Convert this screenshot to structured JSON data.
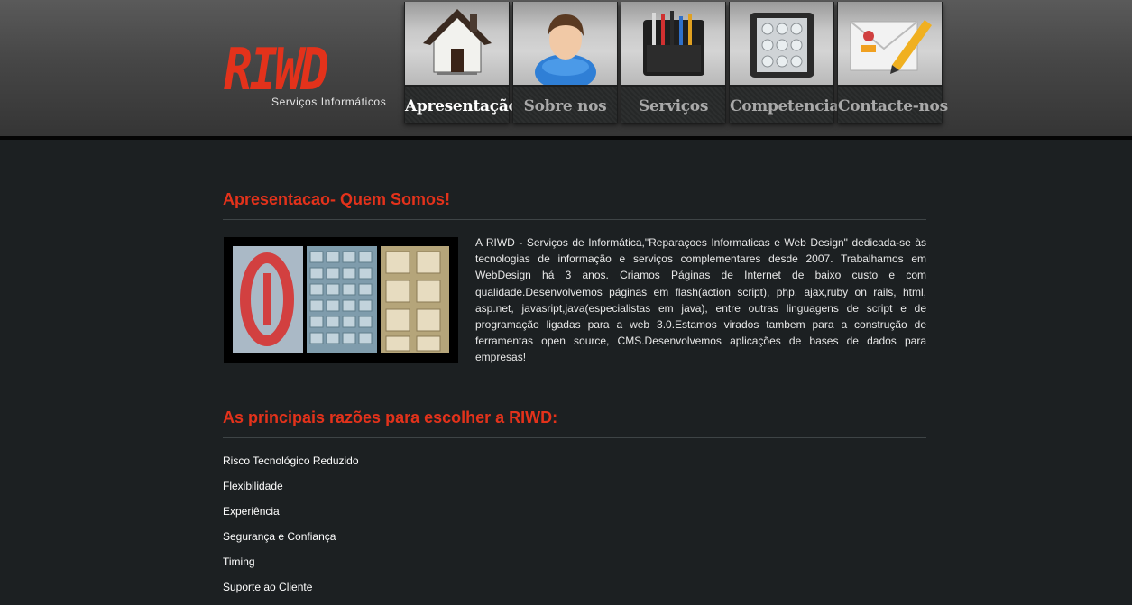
{
  "logo": {
    "title": "RIWD",
    "subtitle": "Serviços Informáticos",
    "color": "#e3321b"
  },
  "nav": {
    "items": [
      {
        "label": "Apresentação",
        "icon": "house-icon",
        "active": true
      },
      {
        "label": "Sobre nos",
        "icon": "person-icon",
        "active": false
      },
      {
        "label": "Serviços",
        "icon": "pencil-case-icon",
        "active": false
      },
      {
        "label": "Competencias",
        "icon": "cd-binder-icon",
        "active": false
      },
      {
        "label": "Contacte-nos",
        "icon": "mail-pencil-icon",
        "active": false
      }
    ]
  },
  "intro": {
    "title": "Apresentacao- Quem Somos!",
    "image": "keyboard-keys-image",
    "text": "A RIWD - Serviços de Informática,\"Reparaçoes Informaticas e Web Design\" dedicada-se às tecnologias de informação e serviços complementares desde 2007. Trabalhamos em WebDesign há 3 anos. Criamos Páginas de Internet de baixo custo e com qualidade.Desenvolvemos páginas em flash(action script), php, ajax,ruby on rails, html, asp.net, javasript,java(especialistas em java), entre outras linguagens de script e de programação ligadas para a web 3.0.Estamos virados tambem para a construção de ferramentas open source, CMS.Desenvolvemos aplicações de bases de dados para empresas!"
  },
  "reasons": {
    "title": "As principais razões para escolher a RIWD:",
    "items": [
      "Risco Tecnológico Reduzido",
      "Flexibilidade",
      "Experiência",
      "Segurança e Confiança",
      "Timing",
      "Suporte ao Cliente"
    ]
  },
  "colors": {
    "accent": "#e3321b",
    "background": "#1c2022",
    "header": "#464646"
  }
}
